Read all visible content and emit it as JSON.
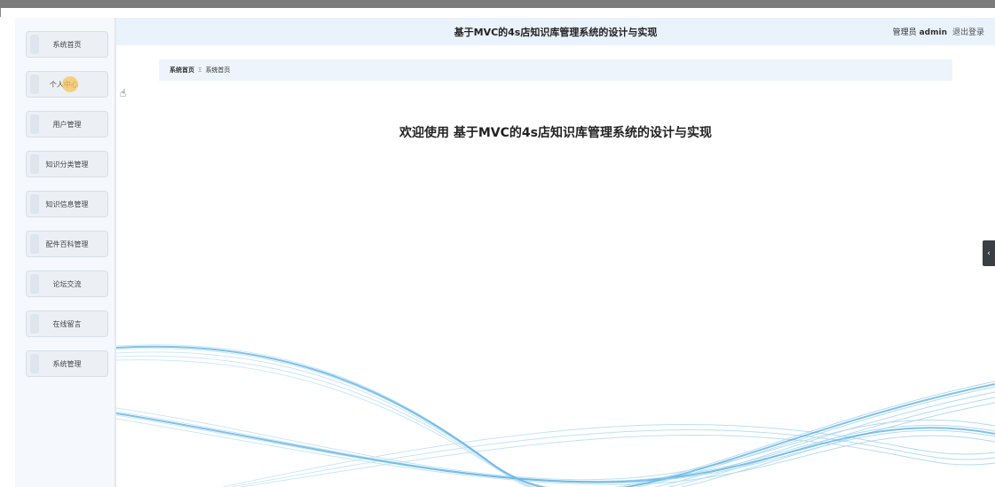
{
  "header": {
    "title": "基于MVC的4s店知识库管理系统的设计与实现",
    "role": "管理员",
    "username": "admin",
    "logout": "退出登录"
  },
  "sidebar": {
    "items": [
      {
        "label": "系统首页"
      },
      {
        "label": "个人中心"
      },
      {
        "label": "用户管理"
      },
      {
        "label": "知识分类管理"
      },
      {
        "label": "知识信息管理"
      },
      {
        "label": "配件百科管理"
      },
      {
        "label": "论坛交流"
      },
      {
        "label": "在线留言"
      },
      {
        "label": "系统管理"
      }
    ]
  },
  "breadcrumb": {
    "home": "系统首页",
    "separator": "Ξ",
    "current": "系统首页"
  },
  "main": {
    "welcome": "欢迎使用 基于MVC的4s店知识库管理系统的设计与实现"
  },
  "colors": {
    "header_bg": "#eaf2fb",
    "wave": "#7fc4ea"
  },
  "icons": {
    "collapse": "chevron-left-icon",
    "cursor": "hand-pointer-icon"
  }
}
